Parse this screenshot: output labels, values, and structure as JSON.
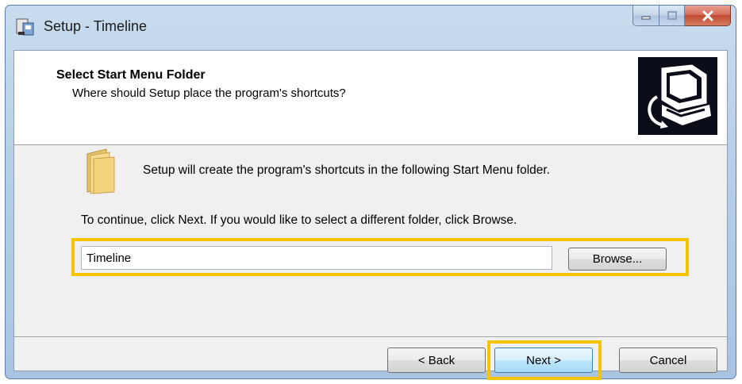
{
  "window": {
    "title": "Setup - Timeline",
    "caption_buttons": [
      "minimize",
      "maximize",
      "close"
    ]
  },
  "header": {
    "title": "Select Start Menu Folder",
    "subtitle": "Where should Setup place the program's shortcuts?"
  },
  "body": {
    "intro": "Setup will create the program's shortcuts in the following Start Menu folder.",
    "continue_text": "To continue, click Next. If you would like to select a different folder, click Browse.",
    "folder_value": "Timeline",
    "browse_label": "Browse..."
  },
  "footer": {
    "back_label": "< Back",
    "next_label": "Next >",
    "cancel_label": "Cancel"
  },
  "colors": {
    "highlight": "#f5c400",
    "title_bar": "#b7cfe8",
    "close_button": "#c04a31"
  },
  "icons": {
    "app": "setup-app-icon",
    "folder": "folder-icon",
    "header": "computer-install-icon"
  }
}
